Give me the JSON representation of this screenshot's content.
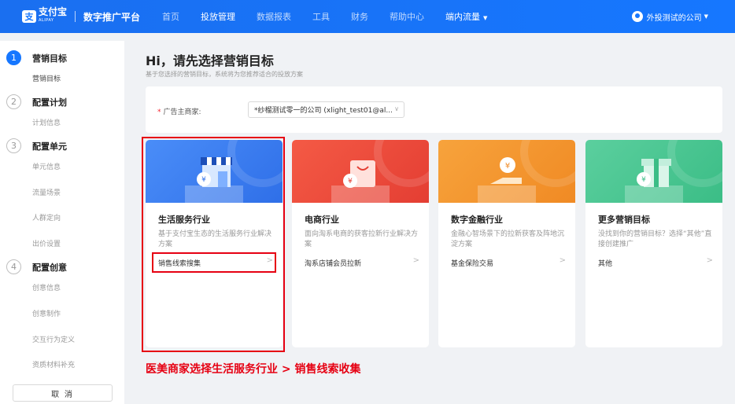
{
  "topbar": {
    "logo_mark": "支",
    "logo_text": "支付宝",
    "logo_sub": "ALIPAY",
    "platform_name": "数字推广平台",
    "nav": [
      {
        "label": "首页"
      },
      {
        "label": "投放管理"
      },
      {
        "label": "数据报表"
      },
      {
        "label": "工具"
      },
      {
        "label": "财务"
      },
      {
        "label": "帮助中心"
      },
      {
        "label": "端内流量"
      }
    ],
    "account_name": "外投测试的公司"
  },
  "sidebar": {
    "steps": [
      {
        "number": "1",
        "title": "营销目标",
        "items": [
          "营销目标"
        ]
      },
      {
        "number": "2",
        "title": "配置计划",
        "items": [
          "计划信息"
        ]
      },
      {
        "number": "3",
        "title": "配置单元",
        "items": [
          "单元信息",
          "流量场景",
          "人群定向",
          "出价设置"
        ]
      },
      {
        "number": "4",
        "title": "配置创意",
        "items": [
          "创意信息",
          "创意制作",
          "交互行为定义",
          "资质材料补充"
        ]
      }
    ],
    "cancel_label": "取 消"
  },
  "main": {
    "title": "Hi，请先选择营销目标",
    "subtitle": "基于您选择的营销目标，系统将为您推荐适合的投放方案",
    "advertiser": {
      "required_mark": "*",
      "label": "广告主商家:",
      "value": "*纱榴测试零一的公司 (xlight_test01@al..."
    },
    "cards": [
      {
        "title": "生活服务行业",
        "desc": "基于支付宝生态的生活服务行业解决方案",
        "link": "销售线索搜集",
        "color1": "#4a8df8",
        "color2": "#2f6fe8"
      },
      {
        "title": "电商行业",
        "desc": "面向淘系电商的获客拉新行业解决方案",
        "link": "淘系店铺会员拉新",
        "color1": "#f45a45",
        "color2": "#e43e33"
      },
      {
        "title": "数字金融行业",
        "desc": "金融心智场景下的拉新获客及阵地沉淀方案",
        "link": "基金保险交易",
        "color1": "#f7a33c",
        "color2": "#f08a24"
      },
      {
        "title": "更多营销目标",
        "desc": "没找到你的营销目标？选择“其他”直接创建推广",
        "link": "其他",
        "color1": "#5bcf9e",
        "color2": "#3bbd86"
      }
    ]
  },
  "annotation": {
    "caption": "医美商家选择生活服务行业 > 销售线索收集",
    "color": "#e60012"
  }
}
